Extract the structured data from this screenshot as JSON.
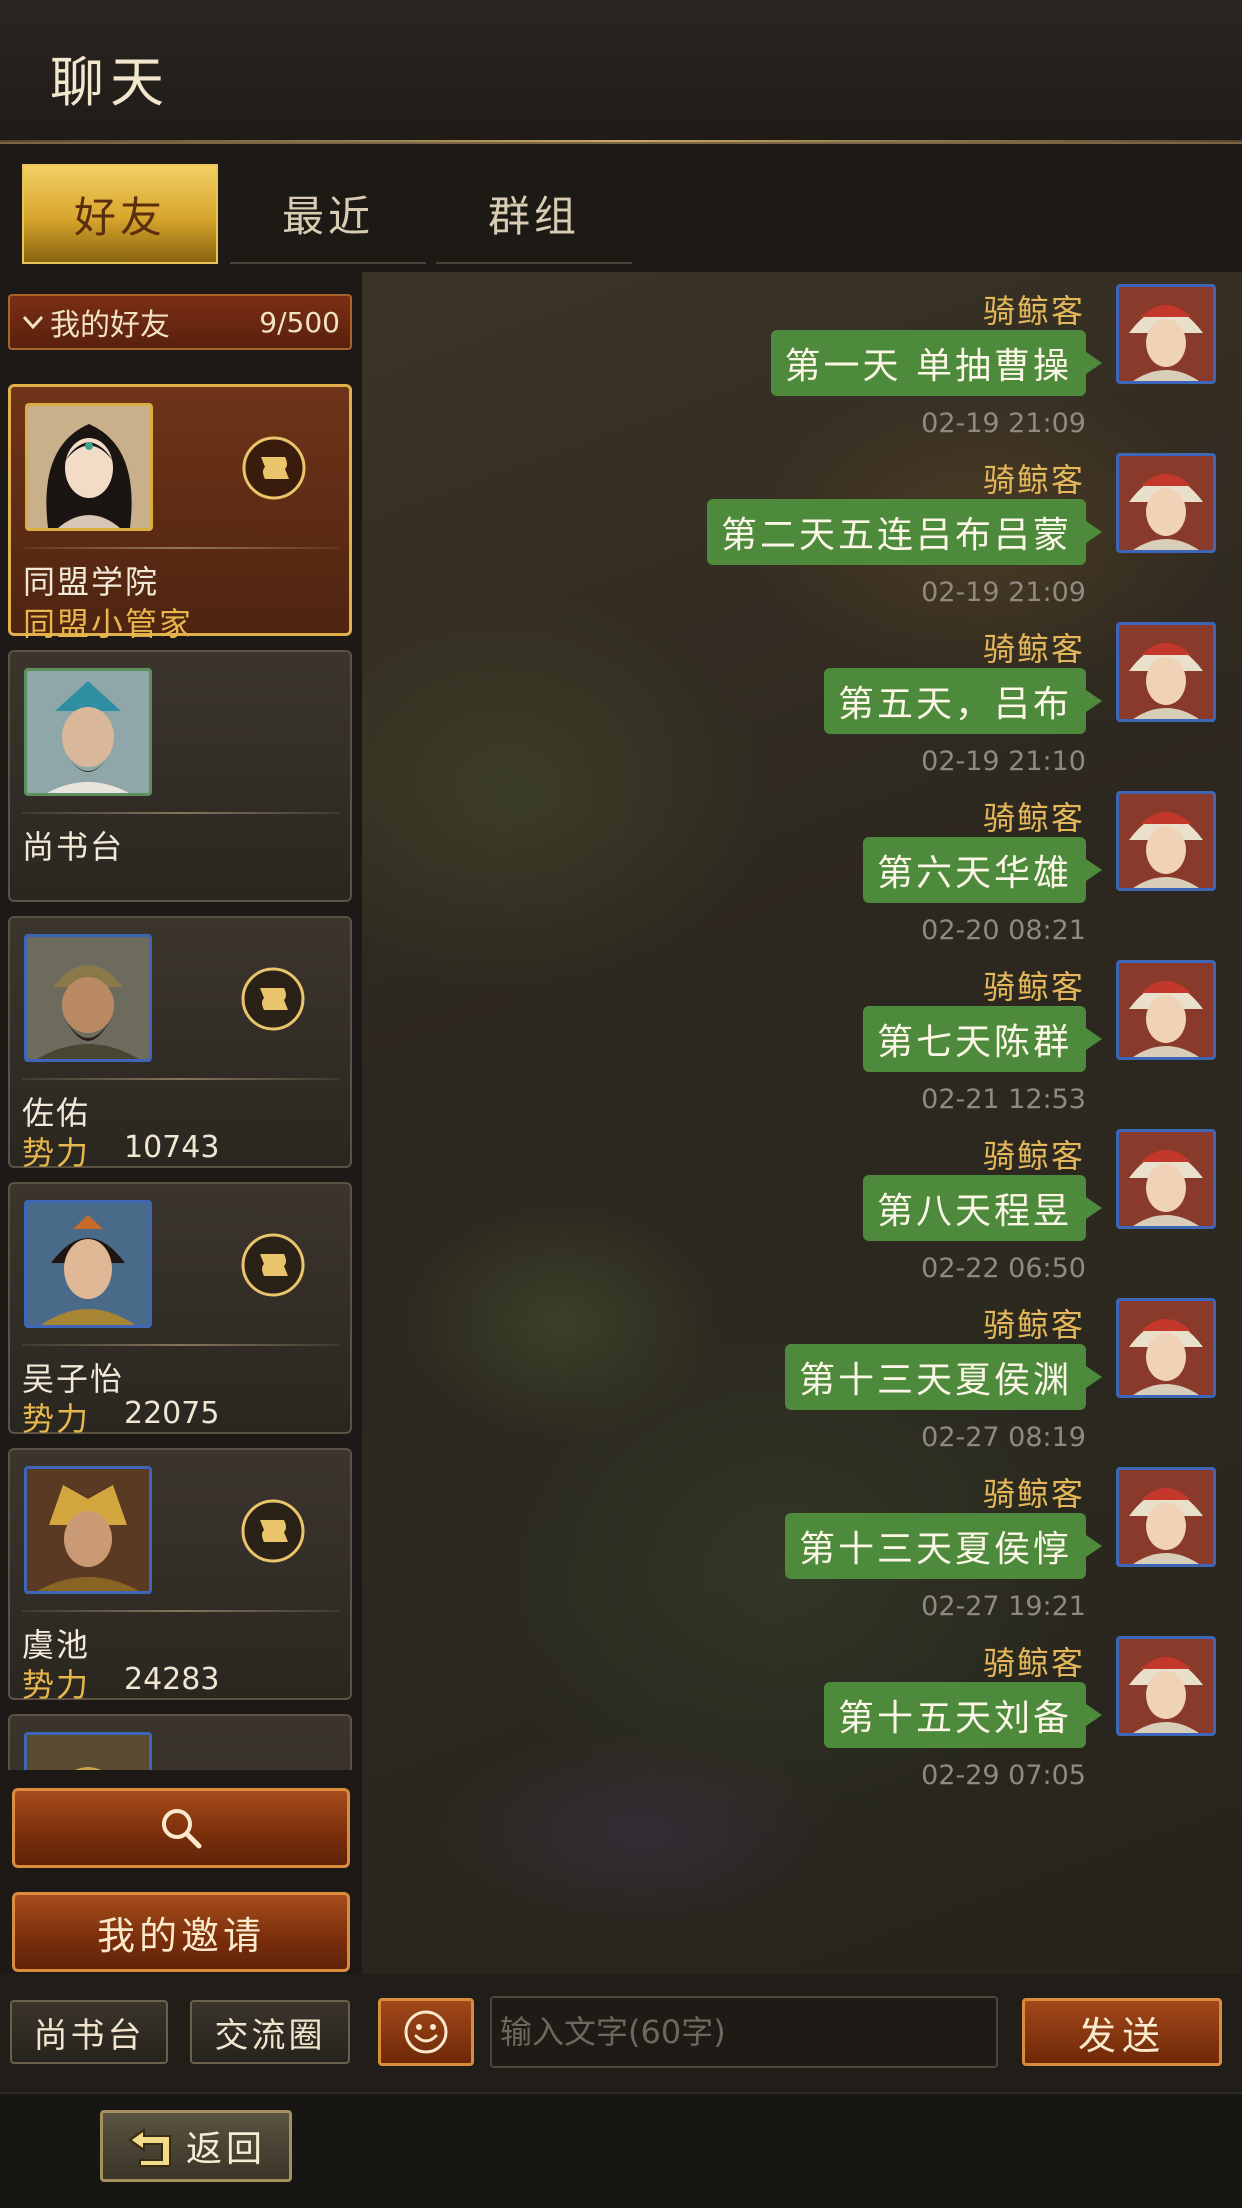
{
  "header": {
    "title": "聊天"
  },
  "tabs": [
    {
      "label": "好友",
      "active": true
    },
    {
      "label": "最近",
      "active": false
    },
    {
      "label": "群组",
      "active": false
    }
  ],
  "friends_group": {
    "label": "我的好友",
    "count": "9/500"
  },
  "friends": [
    {
      "name": "同盟学院",
      "subtitle": "同盟小管家",
      "selected": true,
      "icon": "scroll-icon"
    },
    {
      "name": "尚书台"
    },
    {
      "name": "佐佑",
      "power_label": "势力",
      "power": "10743",
      "icon": "scroll-icon"
    },
    {
      "name": "吴子怡",
      "power_label": "势力",
      "power": "22075",
      "icon": "scroll-icon"
    },
    {
      "name": "虞池",
      "power_label": "势力",
      "power": "24283",
      "icon": "scroll-icon"
    }
  ],
  "left_buttons": {
    "search_icon": "search-icon",
    "invite_label": "我的邀请"
  },
  "messages": [
    {
      "sender": "骑鲸客",
      "text": "第一天 单抽曹操",
      "time": "02-19 21:09"
    },
    {
      "sender": "骑鲸客",
      "text": "第二天五连吕布吕蒙",
      "time": "02-19 21:09"
    },
    {
      "sender": "骑鲸客",
      "text": "第五天，吕布",
      "time": "02-19 21:10"
    },
    {
      "sender": "骑鲸客",
      "text": "第六天华雄",
      "time": "02-20 08:21"
    },
    {
      "sender": "骑鲸客",
      "text": "第七天陈群",
      "time": "02-21 12:53"
    },
    {
      "sender": "骑鲸客",
      "text": "第八天程昱",
      "time": "02-22 06:50"
    },
    {
      "sender": "骑鲸客",
      "text": "第十三天夏侯渊",
      "time": "02-27 08:19"
    },
    {
      "sender": "骑鲸客",
      "text": "第十三天夏侯惇",
      "time": "02-27 19:21"
    },
    {
      "sender": "骑鲸客",
      "text": "第十五天刘备",
      "time": "02-29 07:05"
    }
  ],
  "input_bar": {
    "shangshutai_label": "尚书台",
    "community_label": "交流圈",
    "emoji_icon": "smiley-icon",
    "placeholder": "输入文字(60字)",
    "send_label": "发送"
  },
  "footer": {
    "back_label": "返回",
    "back_icon": "return-arrow-icon"
  },
  "colors": {
    "accent_gold": "#e7b64d",
    "bubble_green": "#4d8a3c",
    "button_orange": "#a2481a"
  }
}
